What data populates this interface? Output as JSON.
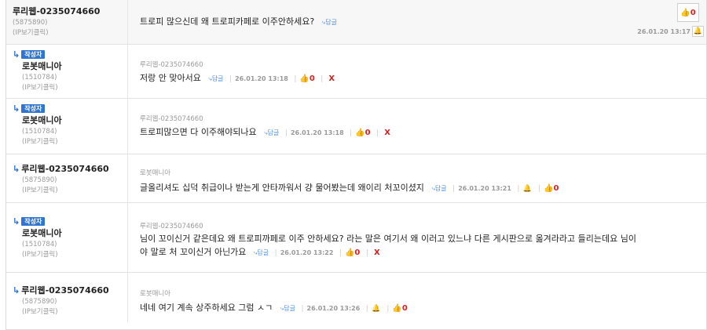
{
  "labels": {
    "author_badge": "작성자",
    "reply": "⤷답글",
    "delete": "X"
  },
  "comments": [
    {
      "nickname": "루리웹-0235074660",
      "user_id": "(5875890)",
      "ip": "(IP보기클릭)",
      "text": "트로피 많으신데 왜 트로피카페로 이주안하세요?",
      "date": "26.01.20 13:17",
      "likes": "0"
    },
    {
      "nickname": "로봇매니아",
      "user_id": "(1510784)",
      "ip": "(IP보기클릭)",
      "reply_to": "루리웹-0235074660",
      "text": "저랑 안 맞아서요",
      "date": "26.01.20 13:18",
      "likes": "0"
    },
    {
      "nickname": "로봇매니아",
      "user_id": "(1510784)",
      "ip": "(IP보기클릭)",
      "reply_to": "루리웹-0235074660",
      "text": "트로피많으면 다 이주해야되나요",
      "date": "26.01.20 13:18",
      "likes": "0"
    },
    {
      "nickname": "루리웹-0235074660",
      "user_id": "(5875890)",
      "ip": "(IP보기클릭)",
      "reply_to": "로봇매니아",
      "text": "글올리셔도 십덕 취급이나 받는게 안타까워서 걍 물어봤는데 왜이리 처꼬이셨지",
      "date": "26.01.20 13:21",
      "likes": "0"
    },
    {
      "nickname": "로봇매니아",
      "user_id": "(1510784)",
      "ip": "(IP보기클릭)",
      "reply_to": "루리웹-0235074660",
      "text_line1": "님이 꼬이신거 같은데요 왜 트로피까페로 이주 안하세요? 라는 말은 여기서 왜 이러고 있느냐 다른 게시판으로 옮겨라라고 들리는데요 님이",
      "text_line2": "야 말로 처 꼬이신거 아닌가요",
      "date": "26.01.20 13:22",
      "likes": "0"
    },
    {
      "nickname": "루리웹-0235074660",
      "user_id": "(5875890)",
      "ip": "(IP보기클릭)",
      "reply_to": "로봇매니아",
      "text": "네네 여기 계속 상주하세요 그럼 ㅅㄱ",
      "date": "26.01.20 13:26",
      "likes": "0"
    }
  ]
}
